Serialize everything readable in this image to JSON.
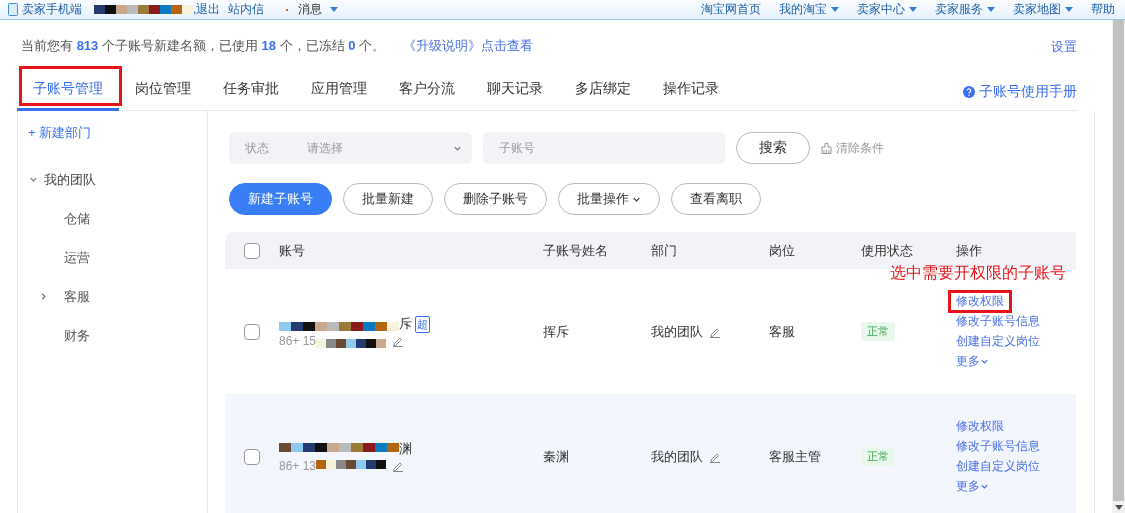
{
  "top_bar": {
    "left": [
      {
        "kind": "app",
        "label": "卖家手机端"
      },
      {
        "kind": "mosaic"
      },
      {
        "kind": "link",
        "label": ",退出"
      },
      {
        "kind": "link",
        "label": "站内信"
      },
      {
        "kind": "menu",
        "label": "消息"
      }
    ],
    "right": [
      {
        "label": "淘宝网首页",
        "dropdown": false
      },
      {
        "label": "我的淘宝",
        "dropdown": true
      },
      {
        "label": "卖家中心",
        "dropdown": true
      },
      {
        "label": "卖家服务",
        "dropdown": true
      },
      {
        "label": "卖家地图",
        "dropdown": true
      },
      {
        "label": "帮助",
        "dropdown": false
      }
    ]
  },
  "info": {
    "segments": [
      {
        "text": "当前您有 ",
        "kind": "plain"
      },
      {
        "text": "813",
        "kind": "number"
      },
      {
        "text": " 个子账号新建名额，已使用 ",
        "kind": "plain"
      },
      {
        "text": "18",
        "kind": "number"
      },
      {
        "text": " 个，已冻结 ",
        "kind": "plain"
      },
      {
        "text": "0",
        "kind": "number"
      },
      {
        "text": " 个。",
        "kind": "plain"
      }
    ],
    "link": "《升级说明》点击查看",
    "settings": "设置"
  },
  "tabs": [
    {
      "label": "子账号管理",
      "selected": true,
      "highlighted": true
    },
    {
      "label": "岗位管理",
      "selected": false,
      "highlighted": false
    },
    {
      "label": "任务审批",
      "selected": false,
      "highlighted": false
    },
    {
      "label": "应用管理",
      "selected": false,
      "highlighted": false
    },
    {
      "label": "客户分流",
      "selected": false,
      "highlighted": false
    },
    {
      "label": "聊天记录",
      "selected": false,
      "highlighted": false
    },
    {
      "label": "多店绑定",
      "selected": false,
      "highlighted": false
    },
    {
      "label": "操作记录",
      "selected": false,
      "highlighted": false
    }
  ],
  "manual_link": "子账号使用手册",
  "sidebar": {
    "new_department": "+ 新建部门",
    "tree": [
      {
        "label": "我的团队",
        "expanded": true,
        "children": [
          {
            "label": "仓储"
          },
          {
            "label": "运营"
          },
          {
            "label": "客服",
            "expanded": false
          },
          {
            "label": "财务"
          }
        ]
      }
    ]
  },
  "filters": {
    "status_label": "状态",
    "status_placeholder": "请选择",
    "account_placeholder": "子账号",
    "search": "搜索",
    "clear": "清除条件"
  },
  "actions": [
    {
      "label": "新建子账号",
      "kind": "primary"
    },
    {
      "label": "批量新建",
      "kind": "default"
    },
    {
      "label": "删除子账号",
      "kind": "default"
    },
    {
      "label": "批量操作",
      "kind": "dropdown"
    },
    {
      "label": "查看离职",
      "kind": "default"
    }
  ],
  "table": {
    "select_all_checked": false,
    "columns": [
      "账号",
      "子账号姓名",
      "部门",
      "岗位",
      "使用状态",
      "操作"
    ],
    "rows": [
      {
        "checked": false,
        "account_tail": "斥",
        "super": "超",
        "phone_head": "86+ 15",
        "name": "挥斥",
        "department": "我的团队",
        "position": "客服",
        "status": "正常",
        "ops": [
          {
            "label": "修改权限",
            "highlighted": true
          },
          {
            "label": "修改子账号信息",
            "highlighted": false
          },
          {
            "label": "创建自定义岗位",
            "highlighted": false
          },
          {
            "label": "更多",
            "highlighted": false
          }
        ]
      },
      {
        "checked": false,
        "account_tail": "渊",
        "phone_head": "86+ 13",
        "name": "秦渊",
        "department": "我的团队",
        "position": "客服主管",
        "status": "正常",
        "ops": [
          {
            "label": "修改权限",
            "highlighted": false
          },
          {
            "label": "修改子账号信息",
            "highlighted": false
          },
          {
            "label": "创建自定义岗位",
            "highlighted": false
          },
          {
            "label": "更多",
            "highlighted": false
          }
        ]
      }
    ]
  },
  "annotation": {
    "text": "选中需要开权限的子账号"
  }
}
